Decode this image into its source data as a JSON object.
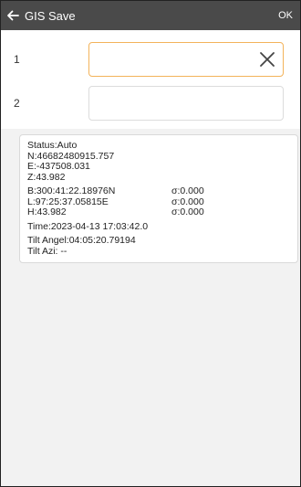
{
  "header": {
    "title": "GIS Save",
    "ok": "OK"
  },
  "form": {
    "rows": [
      {
        "label": "1",
        "value": ""
      },
      {
        "label": "2",
        "value": ""
      }
    ]
  },
  "status": {
    "status": "Status:Auto",
    "n": "N:46682480915.757",
    "e": "E:-437508.031",
    "z": "Z:43.982",
    "b": "B:300:41:22.18976N",
    "b_sigma": "σ:0.000",
    "l": "L:97:25:37.05815E",
    "l_sigma": "σ:0.000",
    "h": "H:43.982",
    "h_sigma": "σ:0.000",
    "time": "Time:2023-04-13 17:03:42.0",
    "tilt_angel": "Tilt Angel:04:05:20.79194",
    "tilt_azi": "Tilt Azi: --"
  },
  "icons": {
    "back": "arrow-left-icon",
    "clear": "close-icon"
  },
  "colors": {
    "header_bg": "#4a4a4a",
    "active_border": "#f3b35a"
  }
}
